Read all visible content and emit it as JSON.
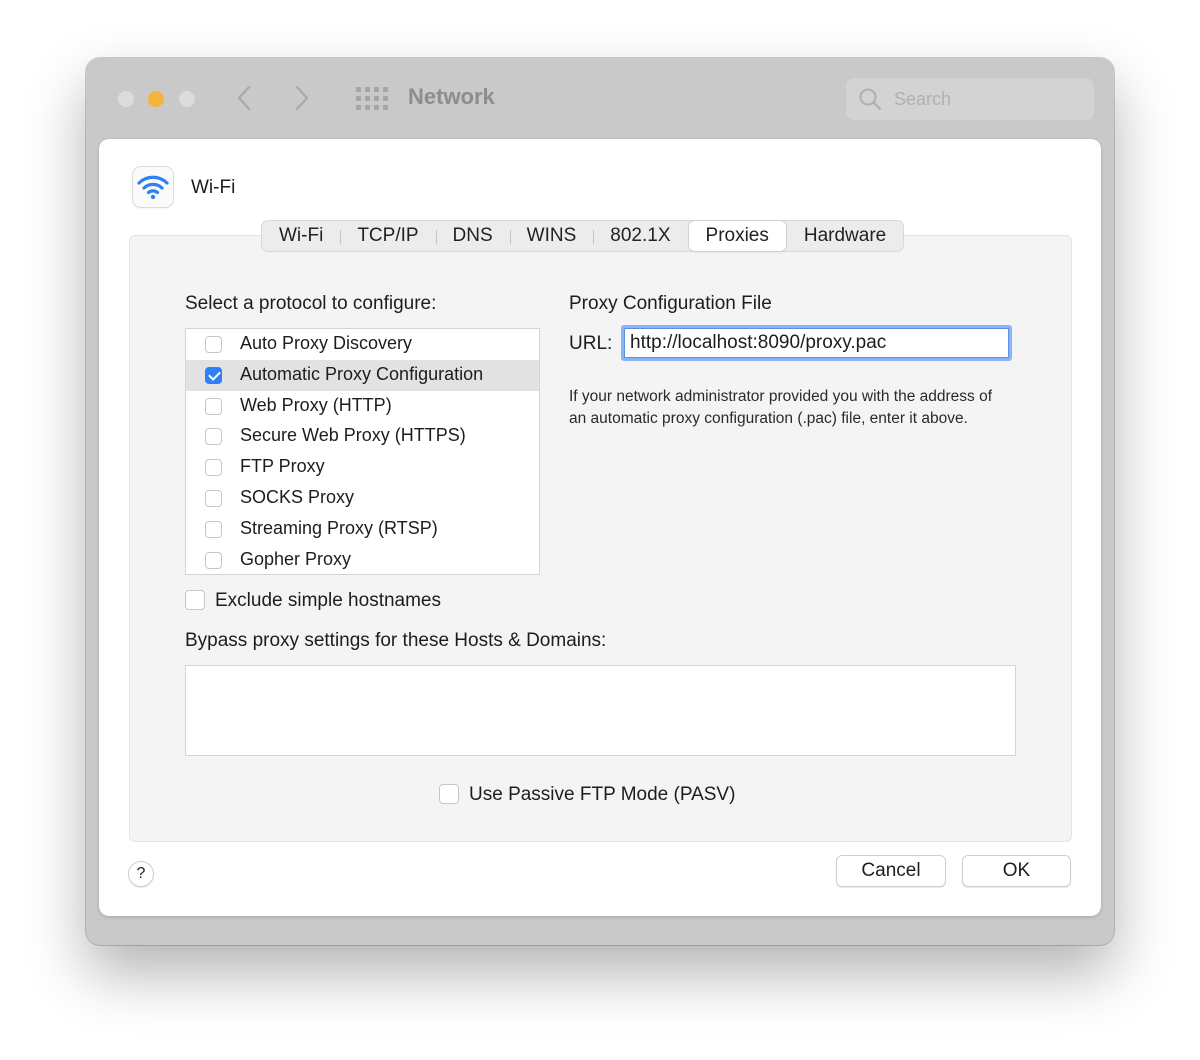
{
  "window": {
    "title": "Network",
    "search_placeholder": "Search"
  },
  "service": {
    "name": "Wi-Fi",
    "icon": "wifi-icon"
  },
  "tabs": [
    {
      "label": "Wi-Fi",
      "active": false
    },
    {
      "label": "TCP/IP",
      "active": false
    },
    {
      "label": "DNS",
      "active": false
    },
    {
      "label": "WINS",
      "active": false
    },
    {
      "label": "802.1X",
      "active": false
    },
    {
      "label": "Proxies",
      "active": true
    },
    {
      "label": "Hardware",
      "active": false
    }
  ],
  "protocols": {
    "title": "Select a protocol to configure:",
    "items": [
      {
        "label": "Auto Proxy Discovery",
        "checked": false,
        "selected": false
      },
      {
        "label": "Automatic Proxy Configuration",
        "checked": true,
        "selected": true
      },
      {
        "label": "Web Proxy (HTTP)",
        "checked": false,
        "selected": false
      },
      {
        "label": "Secure Web Proxy (HTTPS)",
        "checked": false,
        "selected": false
      },
      {
        "label": "FTP Proxy",
        "checked": false,
        "selected": false
      },
      {
        "label": "SOCKS Proxy",
        "checked": false,
        "selected": false
      },
      {
        "label": "Streaming Proxy (RTSP)",
        "checked": false,
        "selected": false
      },
      {
        "label": "Gopher Proxy",
        "checked": false,
        "selected": false
      }
    ]
  },
  "config_file": {
    "title": "Proxy Configuration File",
    "url_label": "URL:",
    "url_value": "http://localhost:8090/proxy.pac",
    "help": "If your network administrator provided you with the address of an automatic proxy configuration (.pac) file, enter it above."
  },
  "exclude": {
    "label": "Exclude simple hostnames",
    "checked": false
  },
  "bypass": {
    "title": "Bypass proxy settings for these Hosts & Domains:",
    "value": ""
  },
  "pasv": {
    "label": "Use Passive FTP Mode (PASV)",
    "checked": false
  },
  "buttons": {
    "help": "?",
    "cancel": "Cancel",
    "ok": "OK"
  },
  "colors": {
    "accent": "#2f7ff6",
    "focus_ring": "#8ab4f8",
    "minimize": "#f5b43a"
  }
}
